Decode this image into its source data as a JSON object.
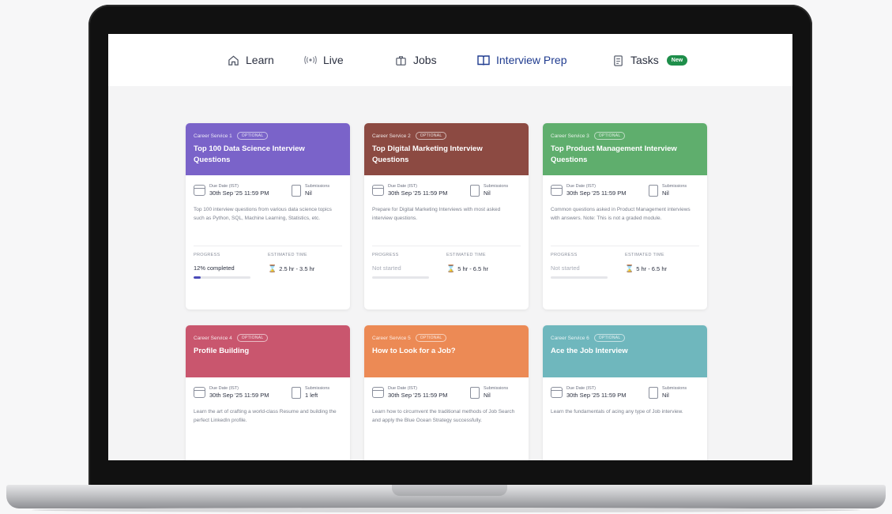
{
  "nav": {
    "items": [
      {
        "label": "Learn",
        "icon": "home-icon"
      },
      {
        "label": "Live",
        "icon": "broadcast-icon"
      },
      {
        "label": "Jobs",
        "icon": "briefcase-icon"
      },
      {
        "label": "Interview Prep",
        "icon": "book-icon",
        "active": true
      },
      {
        "label": "Tasks",
        "icon": "clipboard-icon",
        "badge": "New"
      }
    ]
  },
  "colors": {
    "accent": "#1f3b8f",
    "badge_green": "#1e8e4a",
    "card1": "#7a63c9",
    "card2": "#8c4a42",
    "card3": "#5fae6d",
    "card4": "#c9566e",
    "card5": "#ec8a55",
    "card6": "#6fb7bd"
  },
  "cards": [
    {
      "service": "Career Service 1",
      "optional": "OPTIONAL",
      "title": "Top 100 Data Science Interview Questions",
      "due_label": "Due Date (IST)",
      "due_value": "30th Sep '25 11:59 PM",
      "sub_label": "Submissions",
      "sub_value": "Nil",
      "description": "Top 100 interview questions from various data science topics such as Python, SQL, Machine Learning, Statistics, etc.",
      "progress_label": "PROGRESS",
      "progress_value": "12% completed",
      "progress_fraction": 0.12,
      "time_label": "ESTIMATED TIME",
      "time_value": "2.5 hr - 3.5 hr"
    },
    {
      "service": "Career Service 2",
      "optional": "OPTIONAL",
      "title": "Top Digital Marketing Interview Questions",
      "due_label": "Due Date (IST)",
      "due_value": "30th Sep '25 11:59 PM",
      "sub_label": "Submissions",
      "sub_value": "Nil",
      "description": "Prepare for Digital Marketing Interviews with most asked interview questions.",
      "progress_label": "PROGRESS",
      "progress_value": "Not started",
      "progress_fraction": 0,
      "time_label": "ESTIMATED TIME",
      "time_value": "5 hr - 6.5 hr"
    },
    {
      "service": "Career Service 3",
      "optional": "OPTIONAL",
      "title": "Top Product Management Interview Questions",
      "due_label": "Due Date (IST)",
      "due_value": "30th Sep '25 11:59 PM",
      "sub_label": "Submissions",
      "sub_value": "Nil",
      "description": "Common questions asked in Product Management interviews with answers. Note: This is not a graded module.",
      "progress_label": "PROGRESS",
      "progress_value": "Not started",
      "progress_fraction": 0,
      "time_label": "ESTIMATED TIME",
      "time_value": "5 hr - 6.5 hr"
    },
    {
      "service": "Career Service 4",
      "optional": "OPTIONAL",
      "title": "Profile Building",
      "due_label": "Due Date (IST)",
      "due_value": "30th Sep '25 11:59 PM",
      "sub_label": "Submissions",
      "sub_value": "1 left",
      "description": "Learn the art of crafting a world-class Resume and building the perfect LinkedIn profile."
    },
    {
      "service": "Career Service 5",
      "optional": "OPTIONAL",
      "title": "How to Look for a Job?",
      "due_label": "Due Date (IST)",
      "due_value": "30th Sep '25 11:59 PM",
      "sub_label": "Submissions",
      "sub_value": "Nil",
      "description": "Learn how to circumvent the traditional methods of Job Search and apply the Blue Ocean Strategy successfully."
    },
    {
      "service": "Career Service 6",
      "optional": "OPTIONAL",
      "title": "Ace the Job Interview",
      "due_label": "Due Date (IST)",
      "due_value": "30th Sep '25 11:59 PM",
      "sub_label": "Submissions",
      "sub_value": "Nil",
      "description": "Learn the fundamentals of acing any type of Job interview."
    }
  ]
}
